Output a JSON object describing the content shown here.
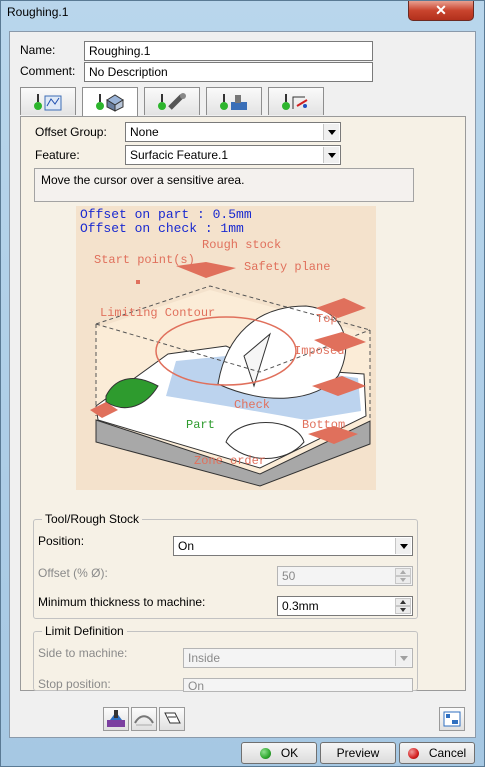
{
  "window": {
    "title": "Roughing.1",
    "close_glyph": "✕"
  },
  "header": {
    "name_label": "Name:",
    "name_value": "Roughing.1",
    "comment_label": "Comment:",
    "comment_value": "No Description"
  },
  "tabs": [
    {
      "icon": "strategy-tab-icon",
      "active": false
    },
    {
      "icon": "geometry-tab-icon",
      "active": true
    },
    {
      "icon": "tool-tab-icon",
      "active": false
    },
    {
      "icon": "feeds-speeds-tab-icon",
      "active": false
    },
    {
      "icon": "macros-tab-icon",
      "active": false
    }
  ],
  "geometry": {
    "offset_group_label": "Offset Group:",
    "offset_group_value": "None",
    "feature_label": "Feature:",
    "feature_value": "Surfacic Feature.1",
    "hint": "Move the cursor over a sensitive area."
  },
  "picture": {
    "offset_part": "Offset on part : 0.5mm",
    "offset_check": "Offset on check : 1mm",
    "rough_stock": "Rough stock",
    "start_points": "Start point(s)",
    "safety_plane": "Safety plane",
    "limiting_contour": "Limiting Contour",
    "top": "Top",
    "imposed": "Imposed",
    "check": "Check",
    "part": "Part",
    "bottom": "Bottom",
    "zone_order": "Zone order"
  },
  "tool_rough_stock": {
    "title": "Tool/Rough Stock",
    "position_label": "Position:",
    "position_value": "On",
    "offset_label": "Offset (% Ø):",
    "offset_value": "50",
    "min_thickness_label": "Minimum thickness to machine:",
    "min_thickness_value": "0.3mm"
  },
  "limit_definition": {
    "title": "Limit Definition",
    "side_label": "Side to machine:",
    "side_value": "Inside",
    "stop_label": "Stop position:",
    "stop_value": "On"
  },
  "buttons": {
    "ok": "OK",
    "preview": "Preview",
    "cancel": "Cancel"
  },
  "colors": {
    "ok_dot": "#2fa82f",
    "cancel_dot": "#d42020",
    "label_salmon": "#e0705c",
    "picture_blue": "#1a2ad0"
  }
}
